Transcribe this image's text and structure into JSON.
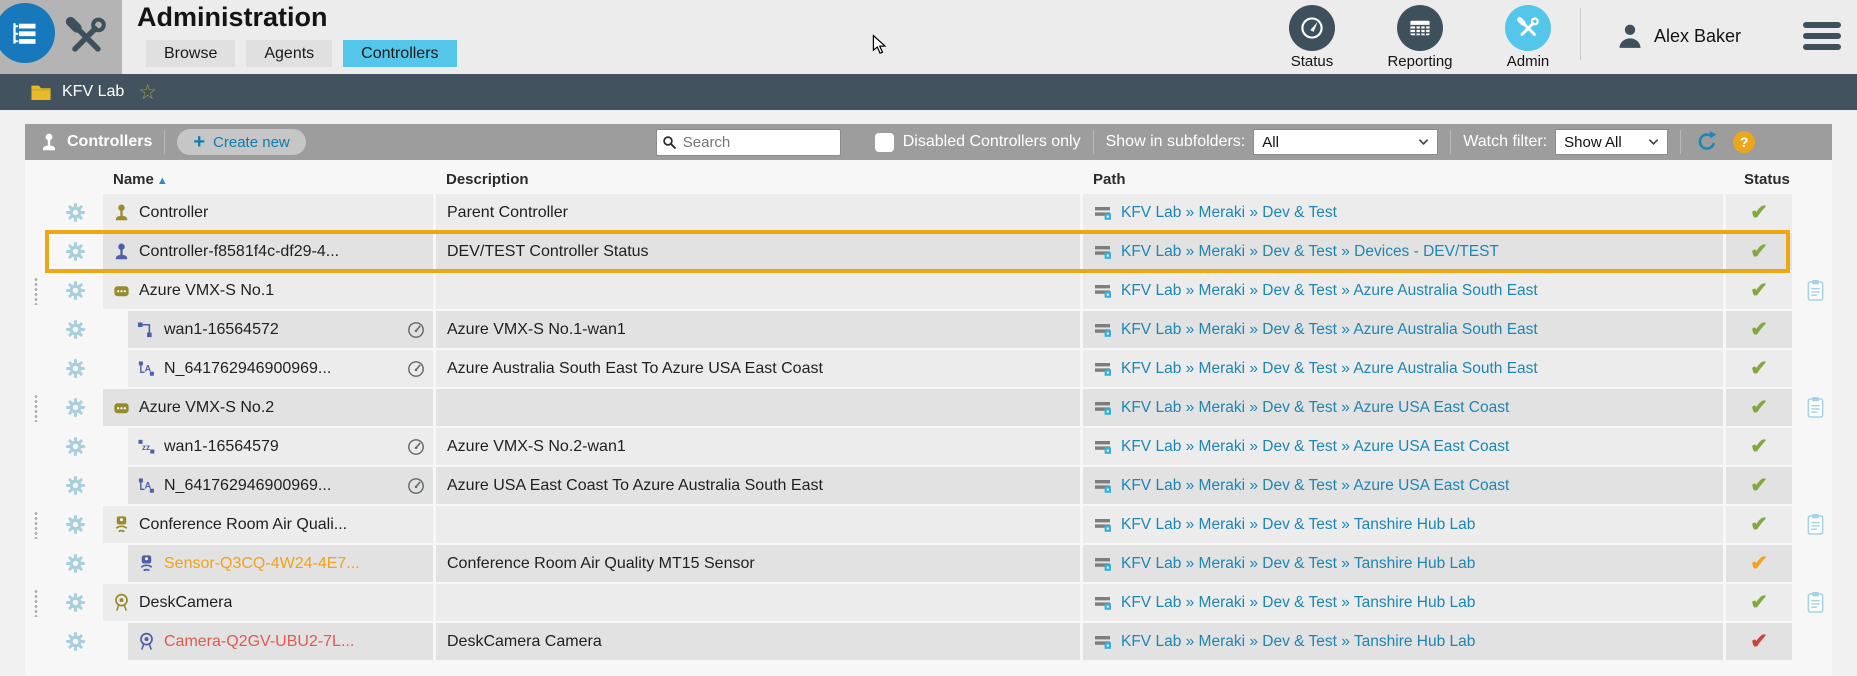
{
  "header": {
    "title": "Administration",
    "tabs": [
      {
        "label": "Browse",
        "active": false
      },
      {
        "label": "Agents",
        "active": false
      },
      {
        "label": "Controllers",
        "active": true
      }
    ],
    "nav": [
      {
        "label": "Status",
        "active": false
      },
      {
        "label": "Reporting",
        "active": false
      },
      {
        "label": "Admin",
        "active": true
      }
    ],
    "user": "Alex Baker"
  },
  "breadcrumb": {
    "folder_label": "KFV Lab",
    "favorite_star": "☆"
  },
  "toolbar": {
    "section_label": "Controllers",
    "create_plus": "+",
    "create_label": "Create new",
    "search_placeholder": "Search",
    "disabled_label": "Disabled Controllers only",
    "subfolders_label": "Show in subfolders:",
    "subfolders_value": "All",
    "watch_label": "Watch filter:",
    "watch_value": "Show All",
    "help_label": "?"
  },
  "table": {
    "columns": {
      "name": "Name",
      "description": "Description",
      "path": "Path",
      "status": "Status"
    },
    "sort_indicator": "▲",
    "status_glyph": "✔",
    "rows": [
      {
        "icon": "joystick",
        "color": "olive",
        "name": "Controller",
        "name_color": "",
        "gauge": false,
        "indent": false,
        "handle": false,
        "clipboard": false,
        "highlighted": false,
        "description": "Parent Controller",
        "path": "KFV Lab » Meraki » Dev & Test",
        "status": "ok"
      },
      {
        "icon": "joystick",
        "color": "blue",
        "name": "Controller-f8581f4c-df29-4...",
        "name_color": "",
        "gauge": false,
        "indent": false,
        "handle": false,
        "clipboard": false,
        "highlighted": true,
        "description": "DEV/TEST Controller Status",
        "path": "KFV Lab » Meraki » Dev & Test » Devices - DEV/TEST",
        "status": "ok"
      },
      {
        "icon": "robot",
        "color": "olive",
        "name": "Azure VMX-S No.1",
        "name_color": "",
        "gauge": false,
        "indent": false,
        "handle": true,
        "clipboard": true,
        "highlighted": false,
        "description": "",
        "path": "KFV Lab » Meraki » Dev & Test » Azure Australia South East",
        "status": "ok"
      },
      {
        "icon": "wan",
        "color": "blue",
        "name": "wan1-16564572",
        "name_color": "",
        "gauge": true,
        "indent": true,
        "handle": false,
        "clipboard": false,
        "highlighted": false,
        "description": "Azure VMX-S No.1-wan1",
        "path": "KFV Lab » Meraki » Dev & Test » Azure Australia South East",
        "status": "ok"
      },
      {
        "icon": "tunnel",
        "color": "blue",
        "name": "N_641762946900969...",
        "name_color": "",
        "gauge": true,
        "indent": true,
        "handle": false,
        "clipboard": false,
        "highlighted": false,
        "description": "Azure Australia South East To Azure USA East Coast",
        "path": "KFV Lab » Meraki » Dev & Test » Azure Australia South East",
        "status": "ok"
      },
      {
        "icon": "robot",
        "color": "olive",
        "name": "Azure VMX-S No.2",
        "name_color": "",
        "gauge": false,
        "indent": false,
        "handle": true,
        "clipboard": true,
        "highlighted": false,
        "description": "",
        "path": "KFV Lab » Meraki » Dev & Test » Azure USA East Coast",
        "status": "ok"
      },
      {
        "icon": "wansleep",
        "color": "blue",
        "name": "wan1-16564579",
        "name_color": "",
        "gauge": true,
        "indent": true,
        "handle": false,
        "clipboard": false,
        "highlighted": false,
        "description": "Azure VMX-S No.2-wan1",
        "path": "KFV Lab » Meraki » Dev & Test » Azure USA East Coast",
        "status": "ok"
      },
      {
        "icon": "tunnel",
        "color": "blue",
        "name": "N_641762946900969...",
        "name_color": "",
        "gauge": true,
        "indent": true,
        "handle": false,
        "clipboard": false,
        "highlighted": false,
        "description": "Azure USA East Coast To Azure Australia South East",
        "path": "KFV Lab » Meraki » Dev & Test » Azure USA East Coast",
        "status": "ok"
      },
      {
        "icon": "sensor",
        "color": "olive",
        "name": "Conference Room Air Quali...",
        "name_color": "",
        "gauge": false,
        "indent": false,
        "handle": true,
        "clipboard": true,
        "highlighted": false,
        "description": "",
        "path": "KFV Lab » Meraki » Dev & Test » Tanshire Hub Lab",
        "status": "ok"
      },
      {
        "icon": "sensor",
        "color": "blue",
        "name": "Sensor-Q3CQ-4W24-4E7...",
        "name_color": "orange",
        "gauge": false,
        "indent": true,
        "handle": false,
        "clipboard": false,
        "highlighted": false,
        "description": "Conference Room Air Quality MT15 Sensor",
        "path": "KFV Lab » Meraki » Dev & Test » Tanshire Hub Lab",
        "status": "warn"
      },
      {
        "icon": "camera",
        "color": "olive",
        "name": "DeskCamera",
        "name_color": "",
        "gauge": false,
        "indent": false,
        "handle": true,
        "clipboard": true,
        "highlighted": false,
        "description": "",
        "path": "KFV Lab » Meraki » Dev & Test » Tanshire Hub Lab",
        "status": "ok"
      },
      {
        "icon": "camera",
        "color": "blue",
        "name": "Camera-Q2GV-UBU2-7L...",
        "name_color": "red",
        "gauge": false,
        "indent": true,
        "handle": false,
        "clipboard": false,
        "highlighted": false,
        "description": "DeskCamera Camera",
        "path": "KFV Lab » Meraki » Dev & Test » Tanshire Hub Lab",
        "status": "error"
      }
    ]
  },
  "colors": {
    "accent_blue": "#53c6ea",
    "link_blue": "#1e86b3",
    "status_ok": "#82a83e",
    "status_warn": "#f0a41d",
    "status_error": "#c9463d",
    "highlight_border": "#eda714",
    "toolbar_gray": "#9d9d9d",
    "dark_slate": "#42525e"
  }
}
